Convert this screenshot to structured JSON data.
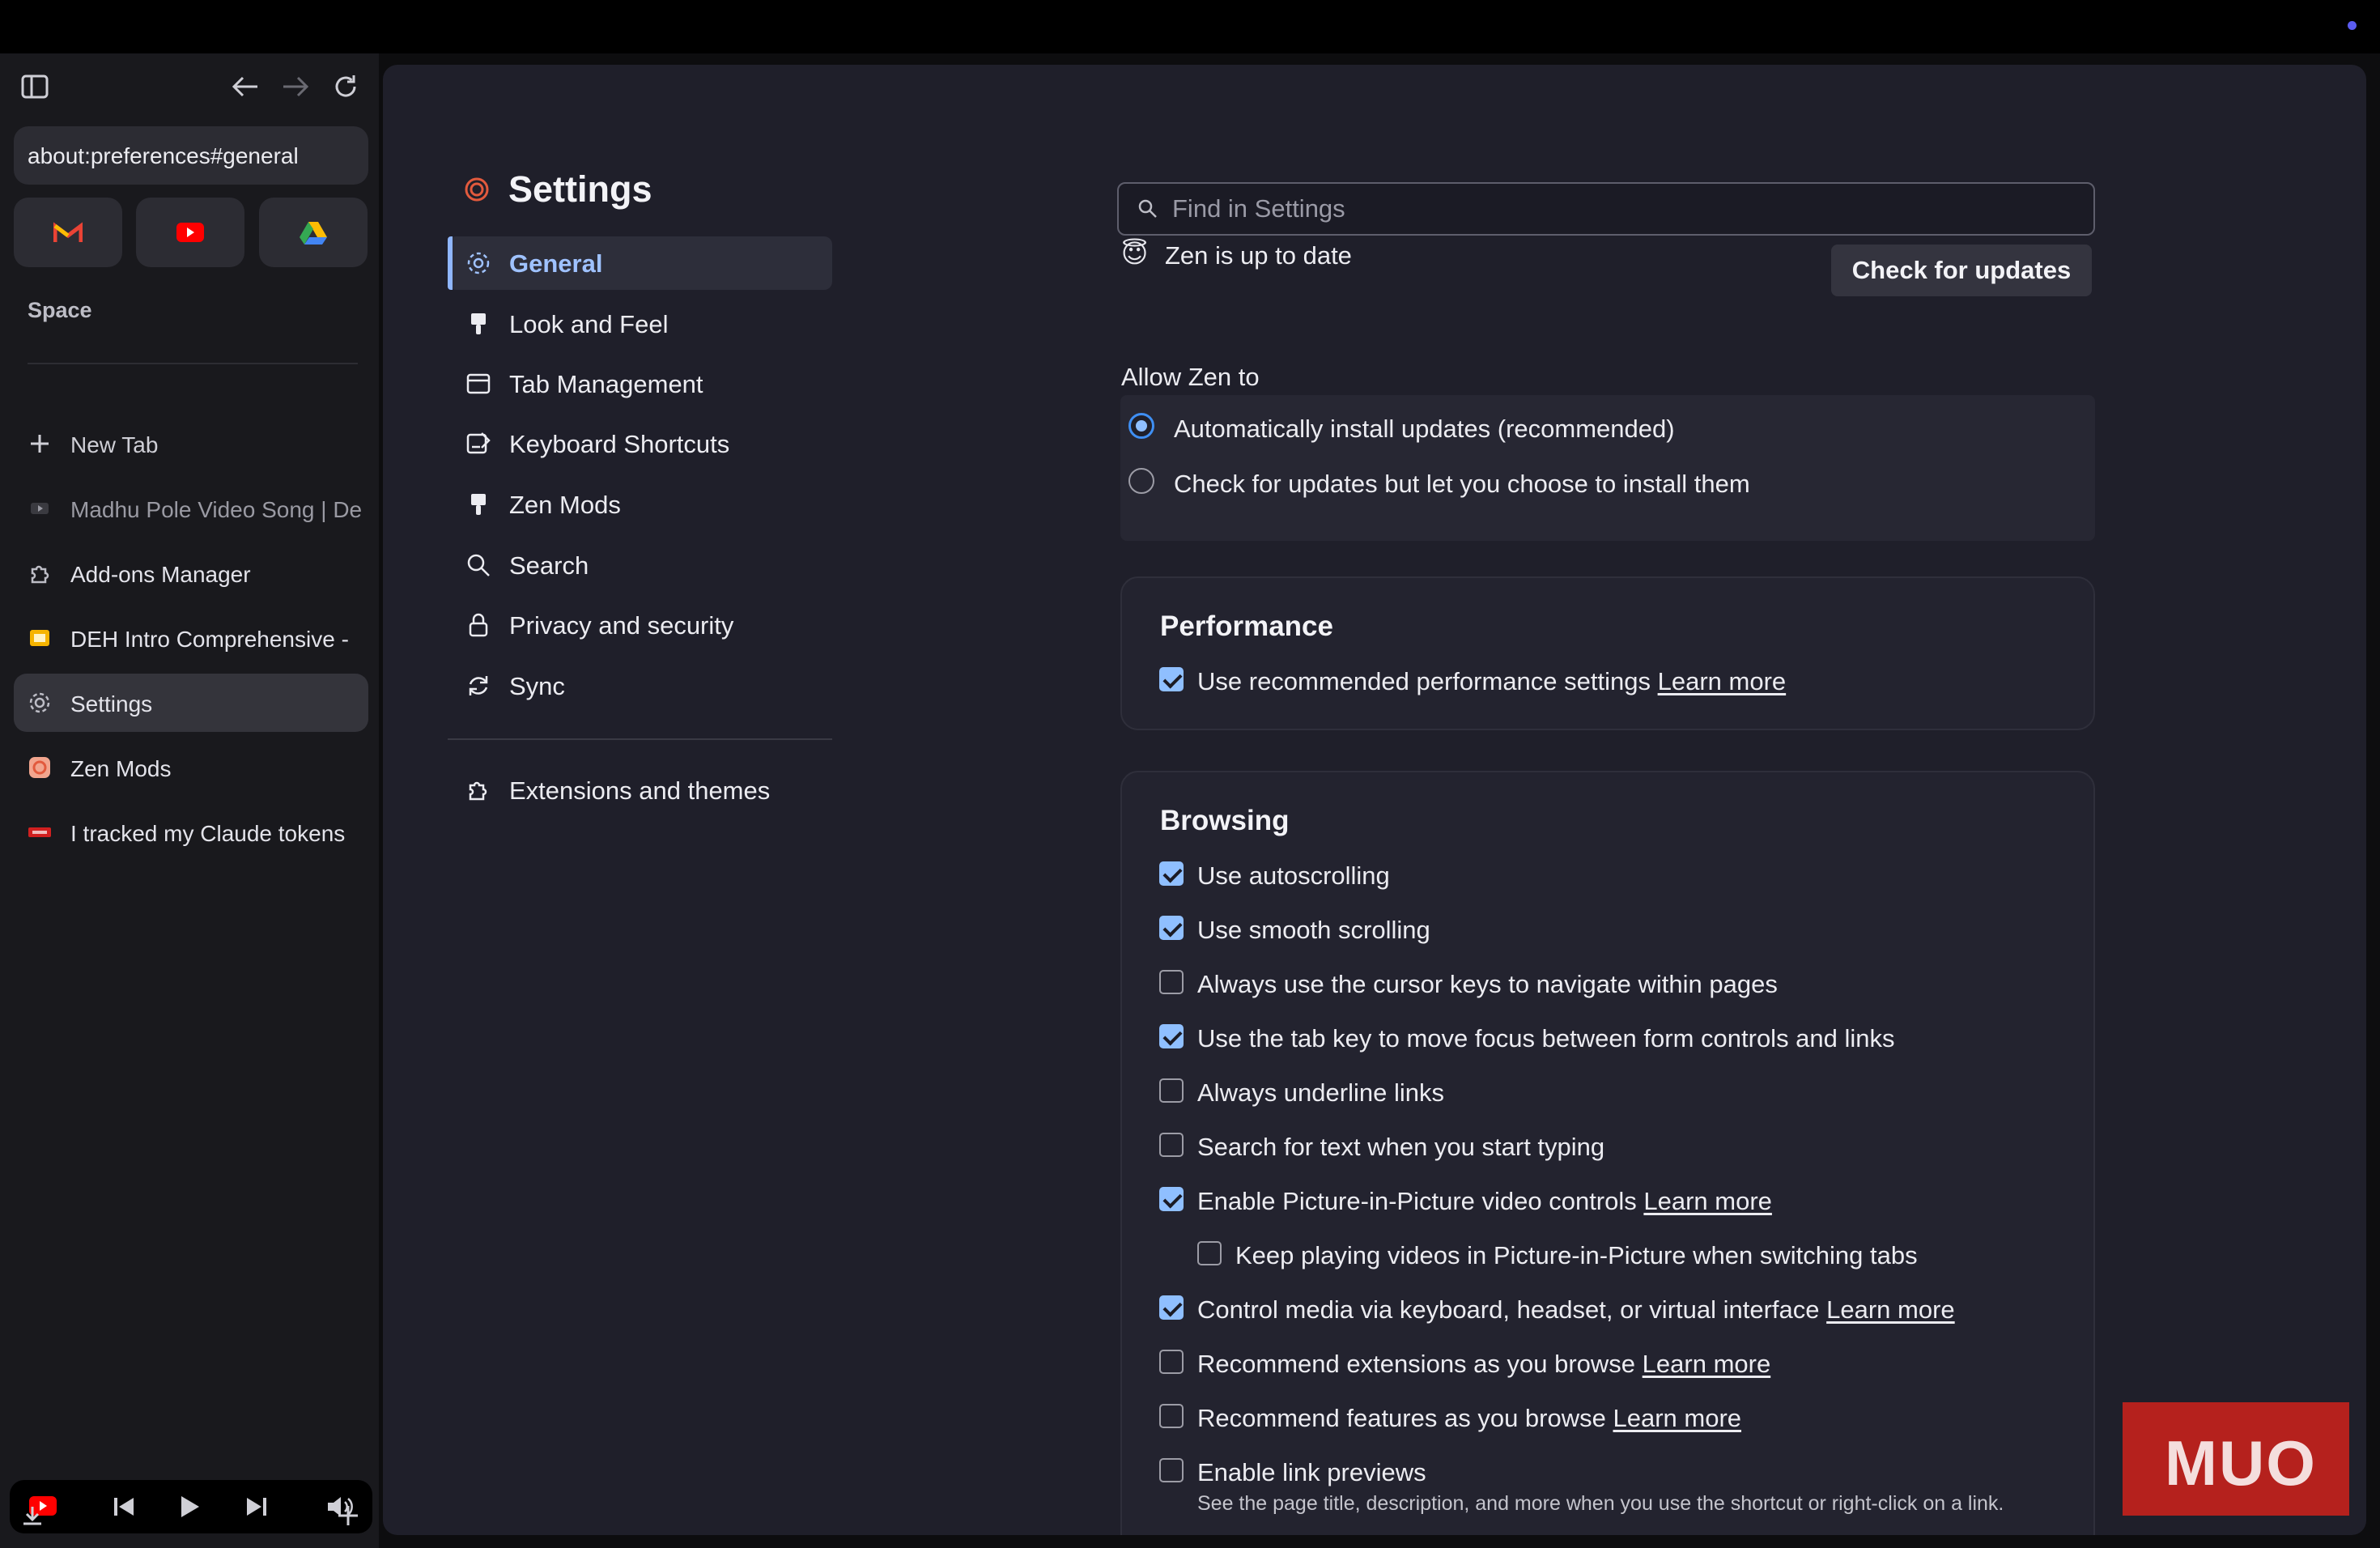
{
  "sidebar": {
    "url": "about:preferences#general",
    "space_label": "Space",
    "tabs": [
      {
        "label": "New Tab",
        "icon": "plus-icon"
      },
      {
        "label": "Madhu Pole Video Song | De",
        "icon": "video-icon"
      },
      {
        "label": "Add-ons Manager",
        "icon": "puzzle-icon"
      },
      {
        "label": "DEH Intro Comprehensive -",
        "icon": "slides-icon"
      },
      {
        "label": "Settings",
        "icon": "gear-icon"
      },
      {
        "label": "Zen Mods",
        "icon": "zen-icon"
      },
      {
        "label": "I tracked my Claude tokens",
        "icon": "muo-icon"
      }
    ]
  },
  "settings": {
    "title": "Settings",
    "nav": [
      {
        "label": "General"
      },
      {
        "label": "Look and Feel"
      },
      {
        "label": "Tab Management"
      },
      {
        "label": "Keyboard Shortcuts"
      },
      {
        "label": "Zen Mods"
      },
      {
        "label": "Search"
      },
      {
        "label": "Privacy and security"
      },
      {
        "label": "Sync"
      }
    ],
    "extensions_label": "Extensions and themes",
    "search_placeholder": "Find in Settings",
    "up_to_date_text": "Zen is up to date",
    "check_updates_label": "Check for updates",
    "allow_label": "Allow Zen to",
    "update_options": [
      {
        "label": "Automatically install updates (recommended)",
        "selected": true
      },
      {
        "label": "Check for updates but let you choose to install them",
        "selected": false
      }
    ],
    "performance": {
      "title": "Performance",
      "option": {
        "label": "Use recommended performance settings",
        "link": "Learn more",
        "checked": true
      }
    },
    "browsing": {
      "title": "Browsing",
      "options": [
        {
          "label": "Use autoscrolling",
          "checked": true
        },
        {
          "label": "Use smooth scrolling",
          "checked": true
        },
        {
          "label": "Always use the cursor keys to navigate within pages",
          "checked": false
        },
        {
          "label": "Use the tab key to move focus between form controls and links",
          "checked": true
        },
        {
          "label": "Always underline links",
          "checked": false
        },
        {
          "label": "Search for text when you start typing",
          "checked": false
        },
        {
          "label": "Enable Picture-in-Picture video controls",
          "link": "Learn more",
          "checked": true
        },
        {
          "label": "Keep playing videos in Picture-in-Picture when switching tabs",
          "checked": false
        },
        {
          "label": "Control media via keyboard, headset, or virtual interface",
          "link": "Learn more",
          "checked": true
        },
        {
          "label": "Recommend extensions as you browse",
          "link": "Learn more",
          "checked": false
        },
        {
          "label": "Recommend features as you browse",
          "link": "Learn more",
          "checked": false
        },
        {
          "label": "Enable link previews",
          "checked": false
        }
      ],
      "link_preview_desc": "See the page title, description, and more when you use the shortcut or right-click on a link."
    }
  },
  "watermark": "MUO",
  "colors": {
    "accent": "#8fbfff",
    "background": "#1f1f2a",
    "sidebar": "#19191d"
  }
}
